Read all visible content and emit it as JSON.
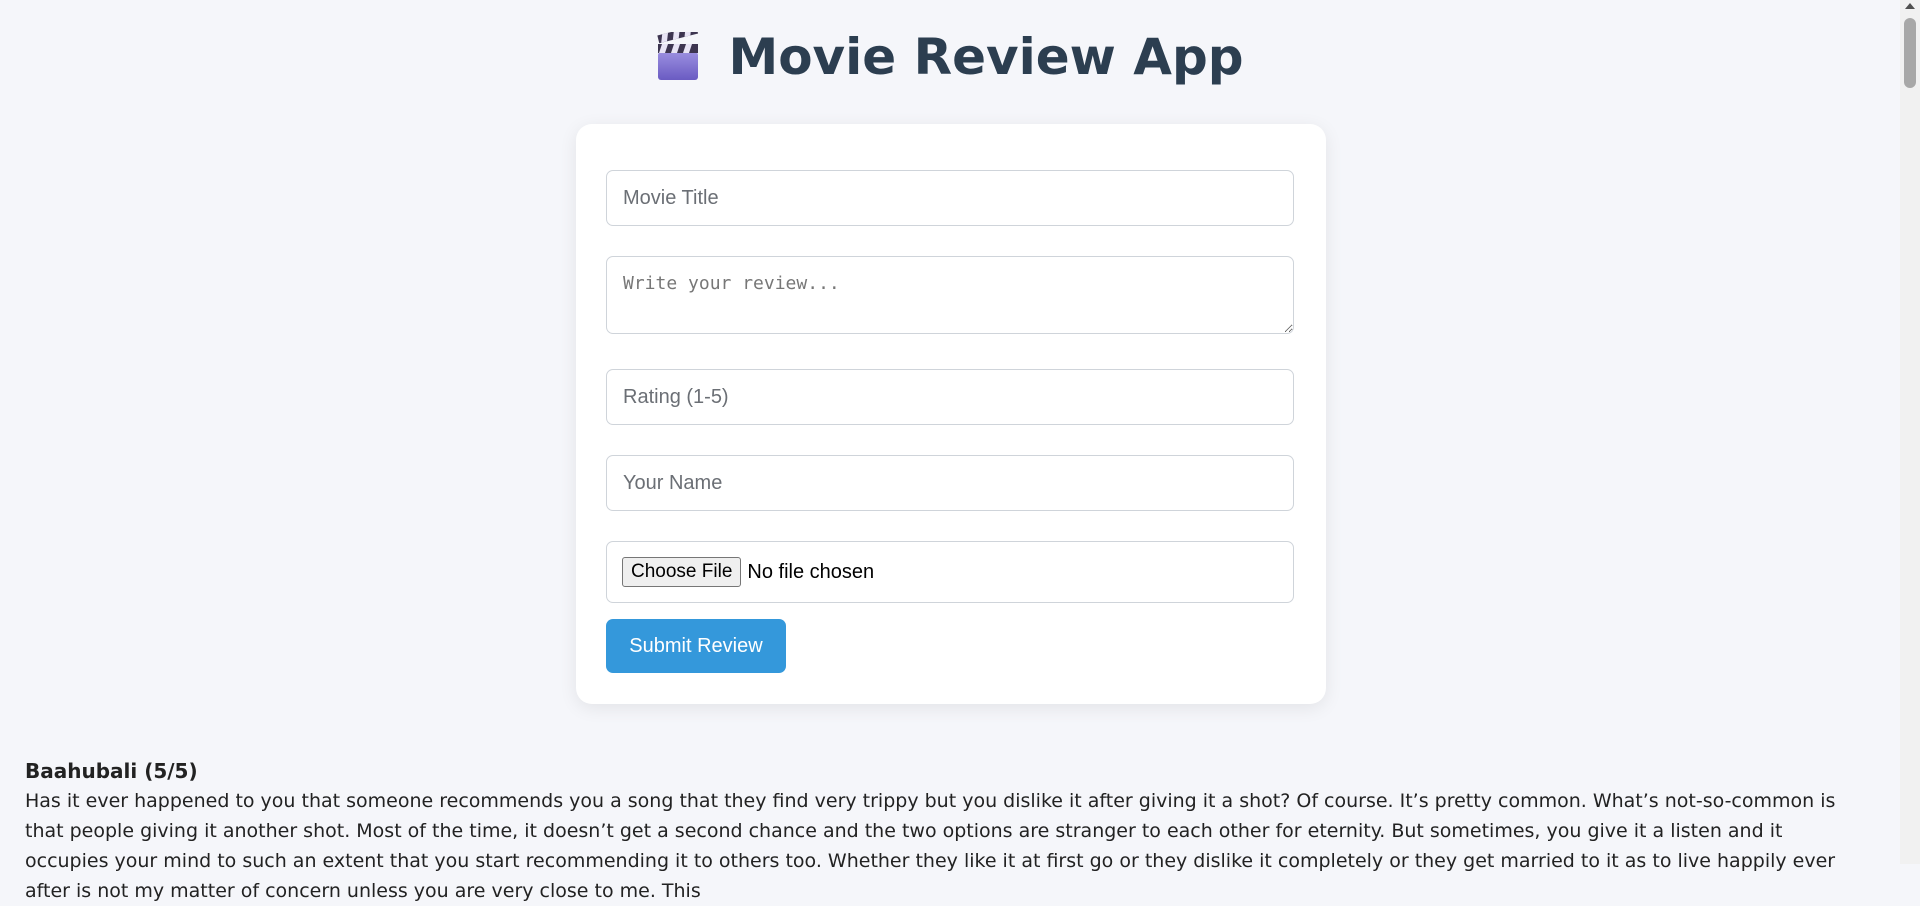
{
  "header": {
    "title": "Movie Review App",
    "icon": "clapperboard-icon"
  },
  "form": {
    "title_placeholder": "Movie Title",
    "review_placeholder": "Write your review...",
    "rating_placeholder": "Rating (1-5)",
    "name_placeholder": "Your Name",
    "file_button_label": "Choose File",
    "file_status": "No file chosen",
    "submit_label": "Submit Review"
  },
  "reviews": [
    {
      "heading": "Baahubali (5/5)",
      "text": "Has it ever happened to you that someone recommends you a song that they find very trippy but you dislike it after giving it a shot? Of course. It’s pretty common. What’s not-so-common is that people giving it another shot. Most of the time, it doesn’t get a second chance and the two options are stranger to each other for eternity. But sometimes, you give it a listen and it occupies your mind to such an extent that you start recommending it to others too. Whether they like it at first go or they dislike it completely or they get married to it as to live happily ever after is not my matter of concern unless you are very close to me. This"
    }
  ],
  "colors": {
    "background": "#f5f6fa",
    "accent": "#3498db",
    "title": "#2c3e50"
  }
}
